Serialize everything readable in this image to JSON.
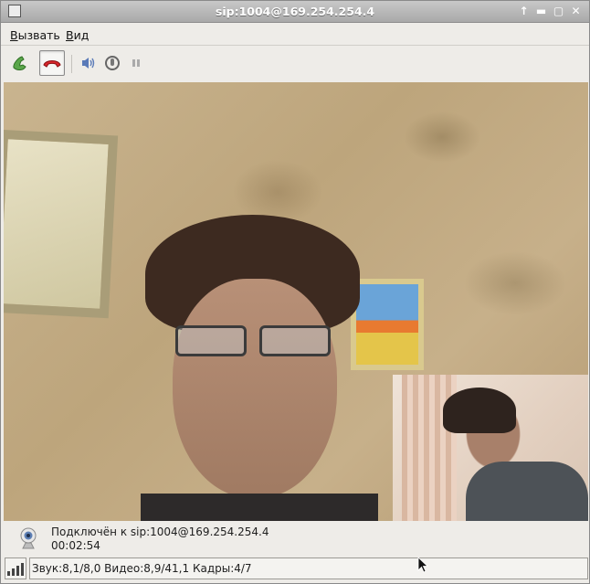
{
  "window": {
    "title": "sip:1004@169.254.254.4"
  },
  "titlebar": {
    "controls": [
      "arrow-up-icon",
      "minimize-icon",
      "maximize-icon",
      "close-icon"
    ]
  },
  "menu": {
    "items": [
      {
        "label": "Вызвать",
        "mnemonic": "В"
      },
      {
        "label": "Вид",
        "mnemonic": "В"
      }
    ]
  },
  "toolbar": {
    "buttons": [
      {
        "icon": "call-answer-icon",
        "pressed": false
      },
      {
        "icon": "hangup-icon",
        "pressed": true
      },
      {
        "icon": "speaker-volume-icon",
        "pressed": false
      },
      {
        "icon": "microphone-icon",
        "pressed": false
      },
      {
        "icon": "pause-icon",
        "pressed": false
      }
    ]
  },
  "status": {
    "connection": "Подключён к sip:1004@169.254.254.4",
    "duration": "00:02:54"
  },
  "stats": {
    "text": "Звук:8,1/8,0 Видео:8,9/41,1  Кадры:4/7"
  },
  "colors": {
    "hangup": "#d8262b",
    "answer": "#4a9a3a",
    "titlebar": "#b5b5b5",
    "window_bg": "#eeece8"
  }
}
